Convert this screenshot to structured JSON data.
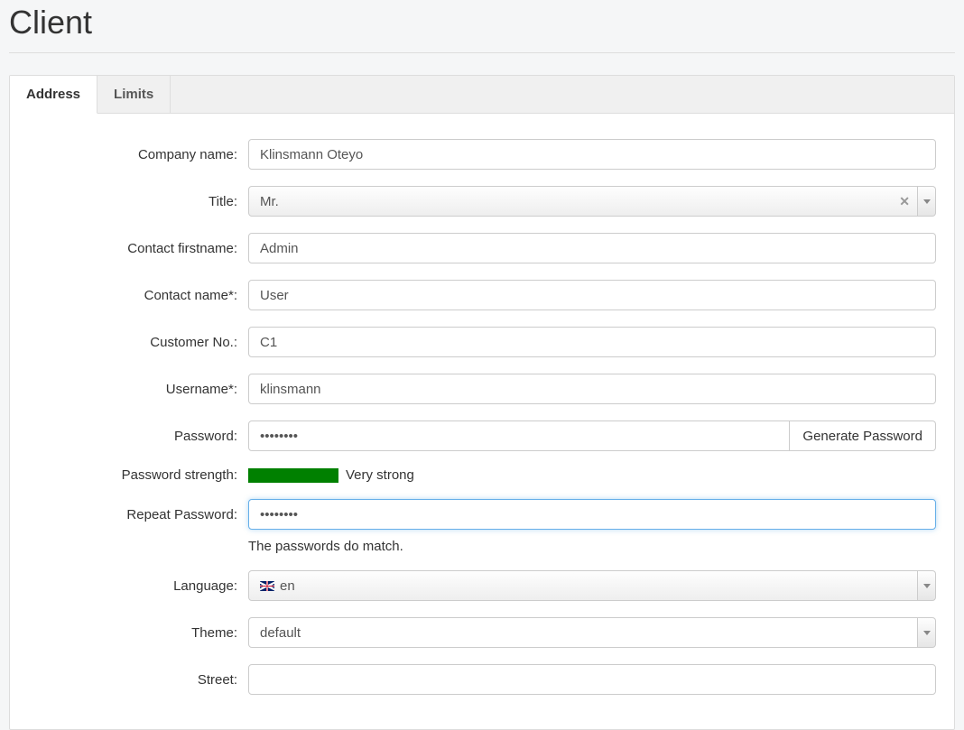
{
  "page": {
    "title": "Client"
  },
  "tabs": {
    "address": "Address",
    "limits": "Limits"
  },
  "form": {
    "company_name": {
      "label": "Company name:",
      "value": "Klinsmann Oteyo"
    },
    "title": {
      "label": "Title:",
      "value": "Mr."
    },
    "contact_firstname": {
      "label": "Contact firstname:",
      "value": "Admin"
    },
    "contact_name": {
      "label": "Contact name*:",
      "value": "User"
    },
    "customer_no": {
      "label": "Customer No.:",
      "value": "C1"
    },
    "username": {
      "label": "Username*:",
      "value": "klinsmann"
    },
    "password": {
      "label": "Password:",
      "value": "••••••••",
      "generate": "Generate Password"
    },
    "password_strength": {
      "label": "Password strength:",
      "text": "Very strong"
    },
    "repeat_password": {
      "label": "Repeat Password:",
      "value": "••••••••",
      "match_text": "The passwords do match."
    },
    "language": {
      "label": "Language:",
      "value": "en"
    },
    "theme": {
      "label": "Theme:",
      "value": "default"
    },
    "street": {
      "label": "Street:",
      "value": ""
    }
  }
}
